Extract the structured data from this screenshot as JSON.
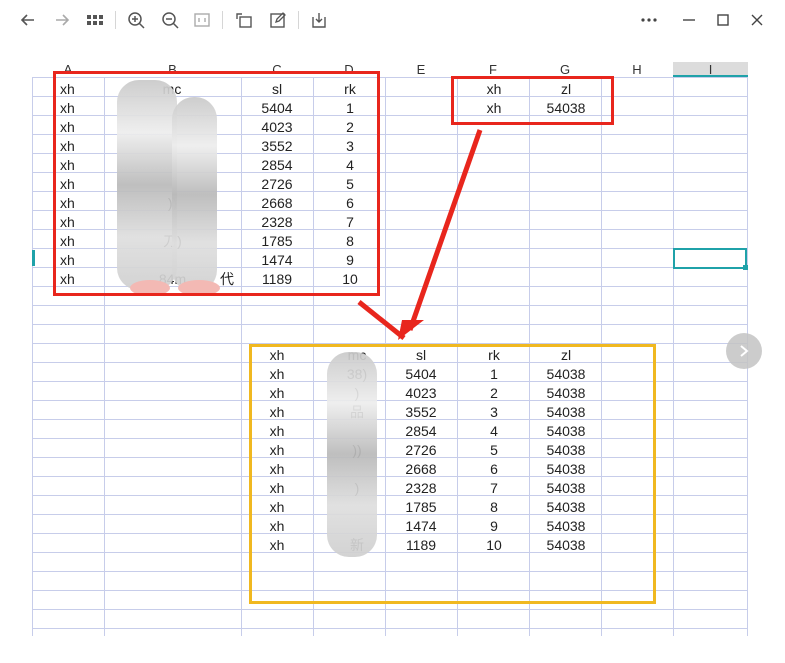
{
  "toolbar": {
    "icons": [
      "back-icon",
      "forward-icon",
      "grid-icon",
      "zoom-in-icon",
      "zoom-out-icon",
      "fit-icon",
      "rotate-icon",
      "edit-icon",
      "download-icon",
      "more-icon",
      "minimize-icon",
      "maximize-icon",
      "close-icon"
    ]
  },
  "columns": [
    "A",
    "B",
    "C",
    "D",
    "E",
    "F",
    "G",
    "H",
    "I"
  ],
  "source_table": {
    "header": {
      "a": "xh",
      "b": "mc",
      "c": "sl",
      "d": "rk"
    },
    "rows": [
      {
        "a": "xh",
        "b": "",
        "c": "5404",
        "d": "1"
      },
      {
        "a": "xh",
        "b": "",
        "c": "4023",
        "d": "2"
      },
      {
        "a": "xh",
        "b": "",
        "c": "3552",
        "d": "3"
      },
      {
        "a": "xh",
        "b": "",
        "c": "2854",
        "d": "4"
      },
      {
        "a": "xh",
        "b": "",
        "c": "2726",
        "d": "5"
      },
      {
        "a": "xh",
        "b": "))",
        "c": "2668",
        "d": "6"
      },
      {
        "a": "xh",
        "b": "",
        "c": "2328",
        "d": "7"
      },
      {
        "a": "xh",
        "b": "刀)",
        "c": "1785",
        "d": "8"
      },
      {
        "a": "xh",
        "b": "",
        "c": "1474",
        "d": "9"
      },
      {
        "a": "xh",
        "b": "84m",
        "b2": "代",
        "c": "1189",
        "d": "10"
      }
    ]
  },
  "lookup_table": {
    "header": {
      "f": "xh",
      "g": "zl"
    },
    "row": {
      "f": "xh",
      "g": "54038"
    }
  },
  "result_table": {
    "header": {
      "a": "xh",
      "b": "mc",
      "c": "sl",
      "d": "rk",
      "e": "zl"
    },
    "rows": [
      {
        "a": "xh",
        "b": "38)",
        "c": "5404",
        "d": "1",
        "e": "54038"
      },
      {
        "a": "xh",
        "b": ")",
        "c": "4023",
        "d": "2",
        "e": "54038"
      },
      {
        "a": "xh",
        "b": "品",
        "c": "3552",
        "d": "3",
        "e": "54038"
      },
      {
        "a": "xh",
        "b": "",
        "c": "2854",
        "d": "4",
        "e": "54038"
      },
      {
        "a": "xh",
        "b": "))",
        "c": "2726",
        "d": "5",
        "e": "54038"
      },
      {
        "a": "xh",
        "b": "",
        "c": "2668",
        "d": "6",
        "e": "54038"
      },
      {
        "a": "xh",
        "b": ")",
        "c": "2328",
        "d": "7",
        "e": "54038"
      },
      {
        "a": "xh",
        "b": "",
        "c": "1785",
        "d": "8",
        "e": "54038"
      },
      {
        "a": "xh",
        "b": "",
        "c": "1474",
        "d": "9",
        "e": "54038"
      },
      {
        "a": "xh",
        "b": "新",
        "c": "1189",
        "d": "10",
        "e": "54038"
      }
    ]
  },
  "colors": {
    "red_highlight": "#e8261d",
    "yellow_highlight": "#f0b820",
    "selection": "#1fa2a9",
    "grid": "#c7cdea"
  }
}
